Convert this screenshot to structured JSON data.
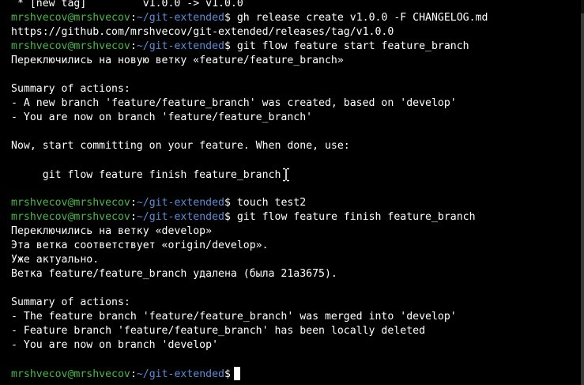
{
  "prompt": {
    "user": "mrshvecov@mrshvecov",
    "path": "~/git-extended",
    "symbol": "$"
  },
  "lines": {
    "l0": " * [new tag]         v1.0.0 -> v1.0.0",
    "l1_cmd": " gh release create v1.0.0 -F CHANGELOG.md",
    "l2": "https://github.com/mrshvecov/git-extended/releases/tag/v1.0.0",
    "l3_cmd": " git flow feature start feature_branch",
    "l4": "Переключились на новую ветку «feature/feature_branch»",
    "l6": "Summary of actions:",
    "l7": "- A new branch 'feature/feature_branch' was created, based on 'develop'",
    "l8": "- You are now on branch 'feature/feature_branch'",
    "l10": "Now, start committing on your feature. When done, use:",
    "l12": "     git flow feature finish feature_branch",
    "l14_cmd": " touch test2",
    "l15_cmd": " git flow feature finish feature_branch",
    "l16": "Переключились на ветку «develop»",
    "l17": "Эта ветка соответствует «origin/develop».",
    "l18": "Уже актуально.",
    "l19": "Ветка feature/feature_branch удалена (была 21a3675).",
    "l21": "Summary of actions:",
    "l22": "- The feature branch 'feature/feature_branch' was merged into 'develop'",
    "l23": "- Feature branch 'feature/feature_branch' has been locally deleted",
    "l24": "- You are now on branch 'develop'"
  }
}
